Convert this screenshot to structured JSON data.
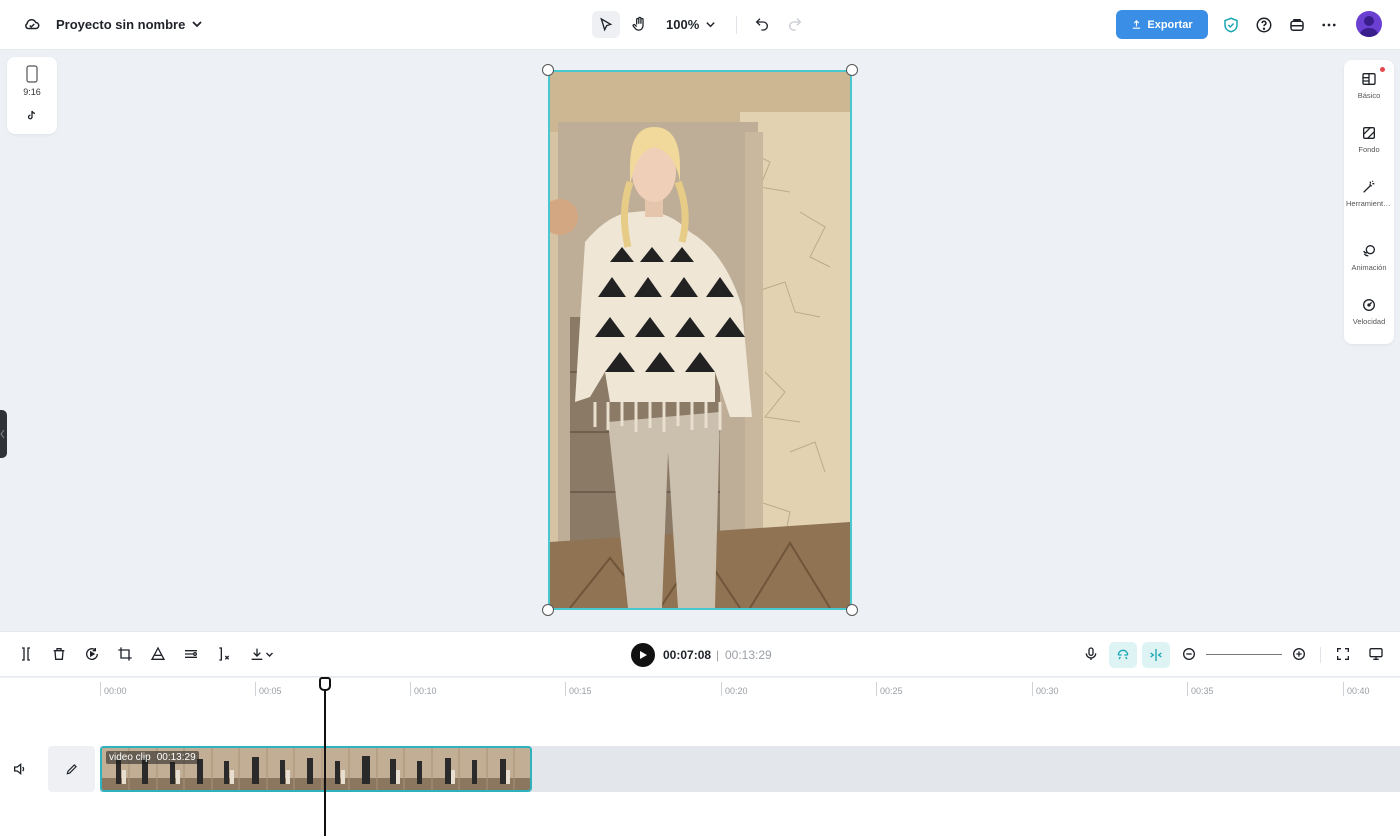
{
  "app": {
    "project_title": "Proyecto sin nombre",
    "zoom": "100%",
    "export_label": "Exportar"
  },
  "left_panel": {
    "aspect_ratio": "9:16",
    "platform_icon": "tiktok-icon"
  },
  "right_panel": {
    "items": [
      {
        "label": "Básico",
        "icon": "basic-panel-icon"
      },
      {
        "label": "Fondo",
        "icon": "background-icon"
      },
      {
        "label": "Herramientas inteligentes",
        "icon": "magic-wand-icon"
      },
      {
        "label": "Animación",
        "icon": "animation-icon"
      },
      {
        "label": "Velocidad",
        "icon": "speed-icon"
      }
    ]
  },
  "playback": {
    "current_time": "00:07:08",
    "separator": "|",
    "total_time": "00:13:29"
  },
  "timeline": {
    "ruler": [
      "00:00",
      "00:05",
      "00:10",
      "00:15",
      "00:20",
      "00:25",
      "00:30",
      "00:35",
      "00:40"
    ],
    "clip": {
      "name": "video clip",
      "duration": "00:13:29"
    }
  },
  "colors": {
    "accent": "#3a8ee6",
    "selection": "#47c7cf",
    "clip_border": "#2cb3be",
    "avatar": "#6b3fd1"
  }
}
